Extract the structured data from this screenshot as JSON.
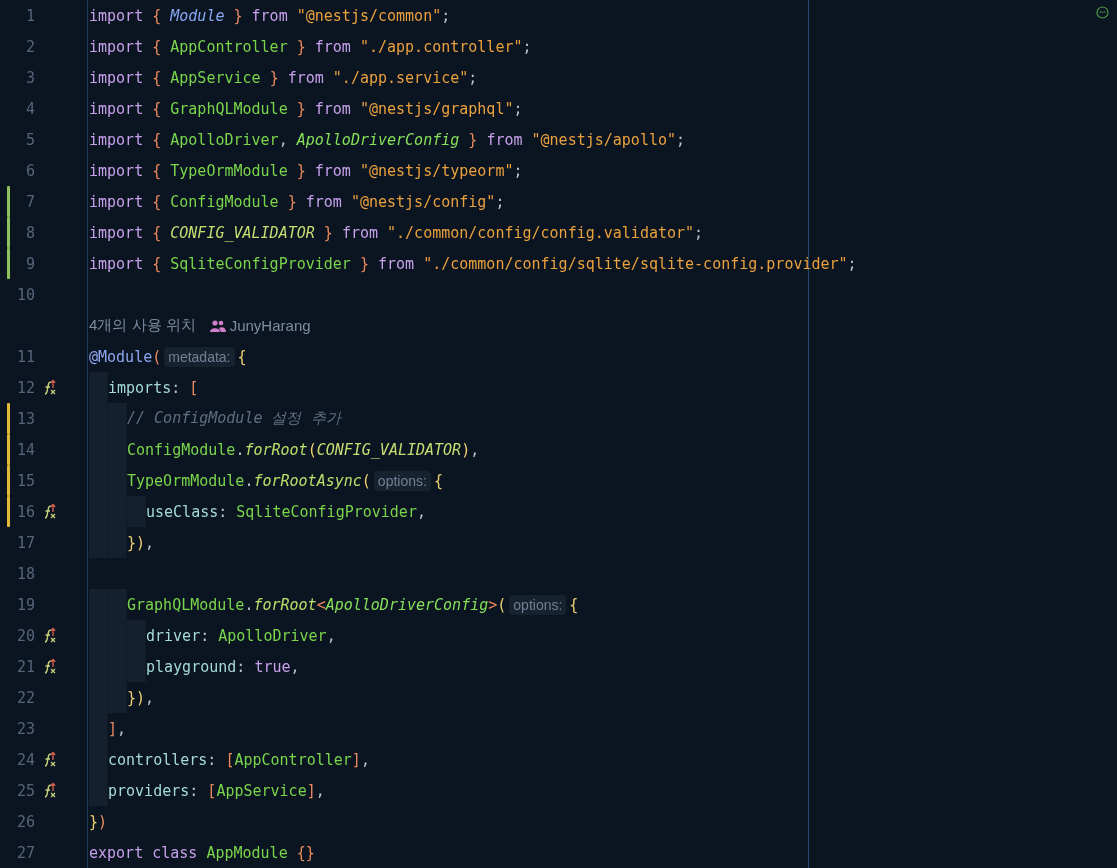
{
  "editor": {
    "lines": [
      {
        "kind": "code",
        "number": "1",
        "override": false,
        "tokens": [
          {
            "kind": "kw",
            "text": "import "
          },
          {
            "kind": "brace",
            "text": "{ "
          },
          {
            "kind": "type-i-blue",
            "text": "Module "
          },
          {
            "kind": "brace",
            "text": "} "
          },
          {
            "kind": "kw",
            "text": "from "
          },
          {
            "kind": "str",
            "text": "\"@nestjs/common\""
          },
          {
            "kind": "punct",
            "text": ";"
          }
        ]
      },
      {
        "kind": "code",
        "number": "2",
        "override": false,
        "tokens": [
          {
            "kind": "kw",
            "text": "import "
          },
          {
            "kind": "brace",
            "text": "{ "
          },
          {
            "kind": "type",
            "text": "AppController "
          },
          {
            "kind": "brace",
            "text": "} "
          },
          {
            "kind": "kw",
            "text": "from "
          },
          {
            "kind": "str",
            "text": "\"./app.controller\""
          },
          {
            "kind": "punct",
            "text": ";"
          }
        ]
      },
      {
        "kind": "code",
        "number": "3",
        "override": false,
        "tokens": [
          {
            "kind": "kw",
            "text": "import "
          },
          {
            "kind": "brace",
            "text": "{ "
          },
          {
            "kind": "type",
            "text": "AppService "
          },
          {
            "kind": "brace",
            "text": "} "
          },
          {
            "kind": "kw",
            "text": "from "
          },
          {
            "kind": "str",
            "text": "\"./app.service\""
          },
          {
            "kind": "punct",
            "text": ";"
          }
        ]
      },
      {
        "kind": "code",
        "number": "4",
        "override": false,
        "tokens": [
          {
            "kind": "kw",
            "text": "import "
          },
          {
            "kind": "brace",
            "text": "{ "
          },
          {
            "kind": "type",
            "text": "GraphQLModule "
          },
          {
            "kind": "brace",
            "text": "} "
          },
          {
            "kind": "kw",
            "text": "from "
          },
          {
            "kind": "str",
            "text": "\"@nestjs/graphql\""
          },
          {
            "kind": "punct",
            "text": ";"
          }
        ]
      },
      {
        "kind": "code",
        "number": "5",
        "override": false,
        "tokens": [
          {
            "kind": "kw",
            "text": "import "
          },
          {
            "kind": "brace",
            "text": "{ "
          },
          {
            "kind": "type",
            "text": "ApolloDriver"
          },
          {
            "kind": "punct",
            "text": ", "
          },
          {
            "kind": "type-i",
            "text": "ApolloDriverConfig "
          },
          {
            "kind": "brace",
            "text": "} "
          },
          {
            "kind": "kw",
            "text": "from "
          },
          {
            "kind": "str",
            "text": "\"@nestjs/apollo\""
          },
          {
            "kind": "punct",
            "text": ";"
          }
        ]
      },
      {
        "kind": "code",
        "number": "6",
        "override": false,
        "tokens": [
          {
            "kind": "kw",
            "text": "import "
          },
          {
            "kind": "brace",
            "text": "{ "
          },
          {
            "kind": "type",
            "text": "TypeOrmModule "
          },
          {
            "kind": "brace",
            "text": "} "
          },
          {
            "kind": "kw",
            "text": "from "
          },
          {
            "kind": "str",
            "text": "\"@nestjs/typeorm\""
          },
          {
            "kind": "punct",
            "text": ";"
          }
        ]
      },
      {
        "kind": "code",
        "number": "7",
        "color": "#8fc25a",
        "override": false,
        "tokens": [
          {
            "kind": "kw",
            "text": "import "
          },
          {
            "kind": "brace",
            "text": "{ "
          },
          {
            "kind": "type",
            "text": "ConfigModule "
          },
          {
            "kind": "brace",
            "text": "} "
          },
          {
            "kind": "kw",
            "text": "from "
          },
          {
            "kind": "str",
            "text": "\"@nestjs/config\""
          },
          {
            "kind": "punct",
            "text": ";"
          }
        ]
      },
      {
        "kind": "code",
        "number": "8",
        "color": "#8fc25a",
        "override": false,
        "tokens": [
          {
            "kind": "kw",
            "text": "import "
          },
          {
            "kind": "brace",
            "text": "{ "
          },
          {
            "kind": "const-i",
            "text": "CONFIG_VALIDATOR "
          },
          {
            "kind": "brace",
            "text": "} "
          },
          {
            "kind": "kw",
            "text": "from "
          },
          {
            "kind": "str",
            "text": "\"./common/config/config.validator\""
          },
          {
            "kind": "punct",
            "text": ";"
          }
        ]
      },
      {
        "kind": "code",
        "number": "9",
        "color": "#8fc25a",
        "override": false,
        "tokens": [
          {
            "kind": "kw",
            "text": "import "
          },
          {
            "kind": "brace",
            "text": "{ "
          },
          {
            "kind": "type",
            "text": "SqliteConfigProvider "
          },
          {
            "kind": "brace",
            "text": "} "
          },
          {
            "kind": "kw",
            "text": "from "
          },
          {
            "kind": "str",
            "text": "\"./common/config/sqlite/sqlite-config.provider\""
          },
          {
            "kind": "punct",
            "text": ";"
          }
        ]
      },
      {
        "kind": "code",
        "number": "10",
        "override": false
      },
      {
        "kind": "lens",
        "usages": "4개의 사용 위치",
        "author": "JunyHarang"
      },
      {
        "kind": "code",
        "number": "11",
        "override": false,
        "tokens": [
          {
            "kind": "deco",
            "text": "@Module"
          },
          {
            "kind": "brace",
            "text": "("
          },
          {
            "kind": "hint",
            "text": "metadata:"
          },
          {
            "kind": "paren",
            "text": "{"
          }
        ]
      },
      {
        "kind": "code",
        "number": "12",
        "override": true,
        "tokens": [
          {
            "kind": "prop",
            "text": "  imports"
          },
          {
            "kind": "punct",
            "text": ": "
          },
          {
            "kind": "brace",
            "text": "["
          }
        ]
      },
      {
        "kind": "code",
        "number": "13",
        "color": "#e0b83a",
        "override": false,
        "tokens": [
          {
            "kind": "comment",
            "text": "    // ConfigModule 설정 추가"
          }
        ]
      },
      {
        "kind": "code",
        "number": "14",
        "color": "#e0b83a",
        "override": false,
        "tokens": [
          {
            "kind": "type",
            "text": "    ConfigModule"
          },
          {
            "kind": "punct",
            "text": "."
          },
          {
            "kind": "fn",
            "text": "forRoot"
          },
          {
            "kind": "paren",
            "text": "("
          },
          {
            "kind": "const-i",
            "text": "CONFIG_VALIDATOR"
          },
          {
            "kind": "paren",
            "text": ")"
          },
          {
            "kind": "punct",
            "text": ","
          }
        ]
      },
      {
        "kind": "code",
        "number": "15",
        "color": "#e0b83a",
        "override": false,
        "tokens": [
          {
            "kind": "type",
            "text": "    TypeOrmModule"
          },
          {
            "kind": "punct",
            "text": "."
          },
          {
            "kind": "fn",
            "text": "forRootAsync"
          },
          {
            "kind": "paren",
            "text": "("
          },
          {
            "kind": "hint",
            "text": "options:"
          },
          {
            "kind": "paren",
            "text": "{"
          }
        ]
      },
      {
        "kind": "code",
        "number": "16",
        "color": "#e0b83a",
        "override": true,
        "tokens": [
          {
            "kind": "prop",
            "text": "      useClass"
          },
          {
            "kind": "punct",
            "text": ": "
          },
          {
            "kind": "type",
            "text": "SqliteConfigProvider"
          },
          {
            "kind": "punct",
            "text": ","
          }
        ]
      },
      {
        "kind": "code",
        "number": "17",
        "override": false,
        "tokens": [
          {
            "kind": "paren",
            "text": "    })"
          },
          {
            "kind": "punct",
            "text": ","
          }
        ]
      },
      {
        "kind": "code",
        "number": "18",
        "override": false
      },
      {
        "kind": "code",
        "number": "19",
        "override": false,
        "tokens": [
          {
            "kind": "type",
            "text": "    GraphQLModule"
          },
          {
            "kind": "punct",
            "text": "."
          },
          {
            "kind": "fn",
            "text": "forRoot"
          },
          {
            "kind": "brace",
            "text": "<"
          },
          {
            "kind": "type-i",
            "text": "ApolloDriverConfig"
          },
          {
            "kind": "brace",
            "text": ">"
          },
          {
            "kind": "paren",
            "text": "("
          },
          {
            "kind": "hint",
            "text": "options:"
          },
          {
            "kind": "paren",
            "text": "{"
          }
        ]
      },
      {
        "kind": "code",
        "number": "20",
        "override": true,
        "tokens": [
          {
            "kind": "prop",
            "text": "      driver"
          },
          {
            "kind": "punct",
            "text": ": "
          },
          {
            "kind": "type",
            "text": "ApolloDriver"
          },
          {
            "kind": "punct",
            "text": ","
          }
        ]
      },
      {
        "kind": "code",
        "number": "21",
        "override": true,
        "tokens": [
          {
            "kind": "prop",
            "text": "      playground"
          },
          {
            "kind": "punct",
            "text": ": "
          },
          {
            "kind": "kw",
            "text": "true"
          },
          {
            "kind": "punct",
            "text": ","
          }
        ]
      },
      {
        "kind": "code",
        "number": "22",
        "override": false,
        "tokens": [
          {
            "kind": "paren",
            "text": "    })"
          },
          {
            "kind": "punct",
            "text": ","
          }
        ]
      },
      {
        "kind": "code",
        "number": "23",
        "override": false,
        "tokens": [
          {
            "kind": "brace",
            "text": "  ]"
          },
          {
            "kind": "punct",
            "text": ","
          }
        ]
      },
      {
        "kind": "code",
        "number": "24",
        "override": true,
        "tokens": [
          {
            "kind": "prop",
            "text": "  controllers"
          },
          {
            "kind": "punct",
            "text": ": "
          },
          {
            "kind": "brace",
            "text": "["
          },
          {
            "kind": "type",
            "text": "AppController"
          },
          {
            "kind": "brace",
            "text": "]"
          },
          {
            "kind": "punct",
            "text": ","
          }
        ]
      },
      {
        "kind": "code",
        "number": "25",
        "override": true,
        "tokens": [
          {
            "kind": "prop",
            "text": "  providers"
          },
          {
            "kind": "punct",
            "text": ": "
          },
          {
            "kind": "brace",
            "text": "["
          },
          {
            "kind": "type",
            "text": "AppService"
          },
          {
            "kind": "brace",
            "text": "]"
          },
          {
            "kind": "punct",
            "text": ","
          }
        ]
      },
      {
        "kind": "code",
        "number": "26",
        "override": false,
        "tokens": [
          {
            "kind": "paren",
            "text": "}"
          },
          {
            "kind": "brace",
            "text": ")"
          }
        ]
      },
      {
        "kind": "code",
        "number": "27",
        "override": false,
        "tokens": [
          {
            "kind": "kw",
            "text": "export class "
          },
          {
            "kind": "type",
            "text": "AppModule "
          },
          {
            "kind": "brace",
            "text": "{}"
          }
        ]
      }
    ]
  }
}
